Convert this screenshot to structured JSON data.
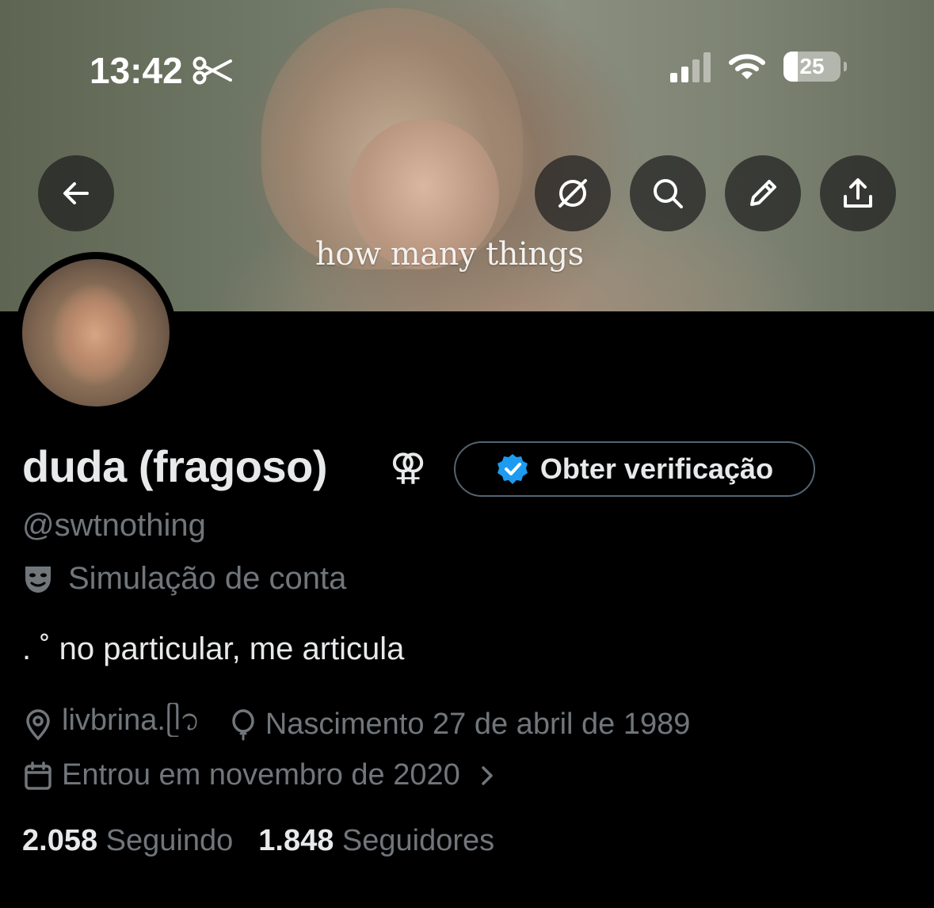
{
  "status_bar": {
    "time": "13:42",
    "battery_level": "25",
    "scissors_icon": "scissors-icon",
    "cell_signal_bars_active": 2,
    "cell_signal_bars_total": 4
  },
  "header": {
    "banner_caption": "how many things",
    "buttons": {
      "back": "arrow-left-icon",
      "grok": "grok-icon",
      "search": "search-icon",
      "edit": "pencil-icon",
      "share": "share-icon"
    }
  },
  "profile": {
    "display_name": "duda (fragoso)",
    "name_symbol": "⚢",
    "verify_button_label": "Obter verificação",
    "handle": "@swtnothing",
    "parody_label": "Simulação de conta",
    "bio": ". ˚ no particular, me articula",
    "location": "livbrina.ᥫ᭡",
    "birthday": "Nascimento 27 de abril de 1989",
    "joined": "Entrou em novembro de 2020"
  },
  "stats": {
    "following_count": "2.058",
    "following_label": "Seguindo",
    "followers_count": "1.848",
    "followers_label": "Seguidores"
  },
  "colors": {
    "background": "#000000",
    "primary_text": "#e7e9ea",
    "secondary_text": "#71767b",
    "verified_blue": "#1d9bf0",
    "border": "#536471"
  }
}
